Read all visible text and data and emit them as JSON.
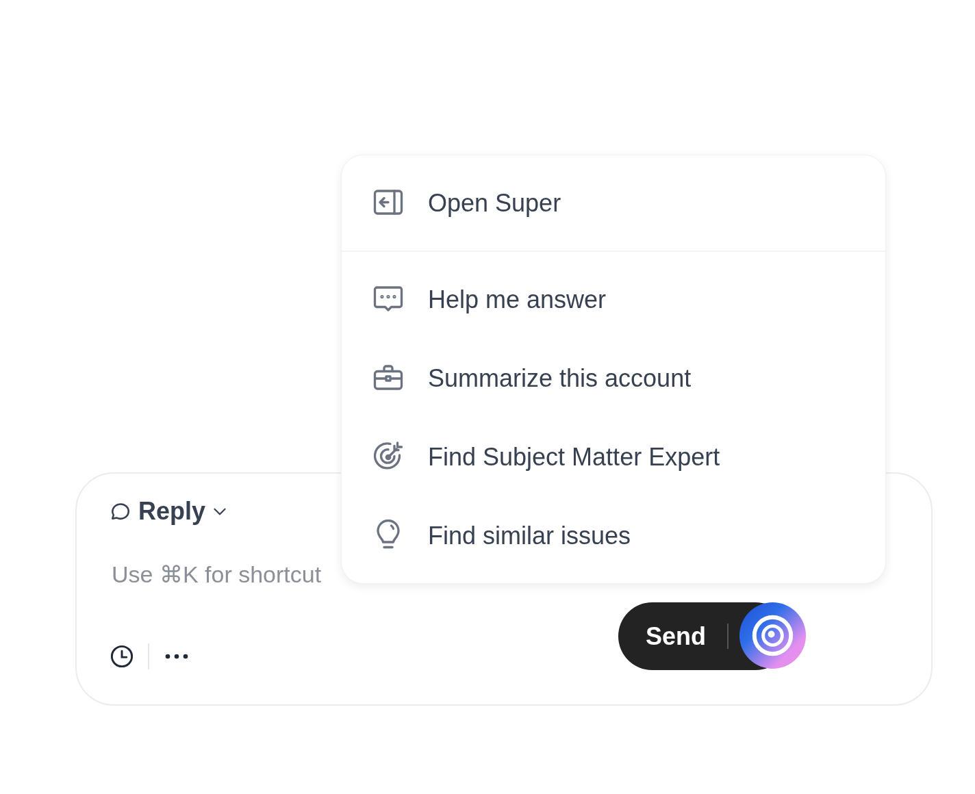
{
  "composer": {
    "mode": "Reply",
    "placeholder": "Use ⌘K for shortcut",
    "send_label": "Send"
  },
  "menu": {
    "sections": [
      {
        "items": [
          {
            "label": "Open Super"
          }
        ]
      },
      {
        "items": [
          {
            "label": "Help me answer"
          },
          {
            "label": "Summarize this account"
          },
          {
            "label": "Find Subject Matter Expert"
          },
          {
            "label": "Find similar issues"
          }
        ]
      }
    ]
  }
}
